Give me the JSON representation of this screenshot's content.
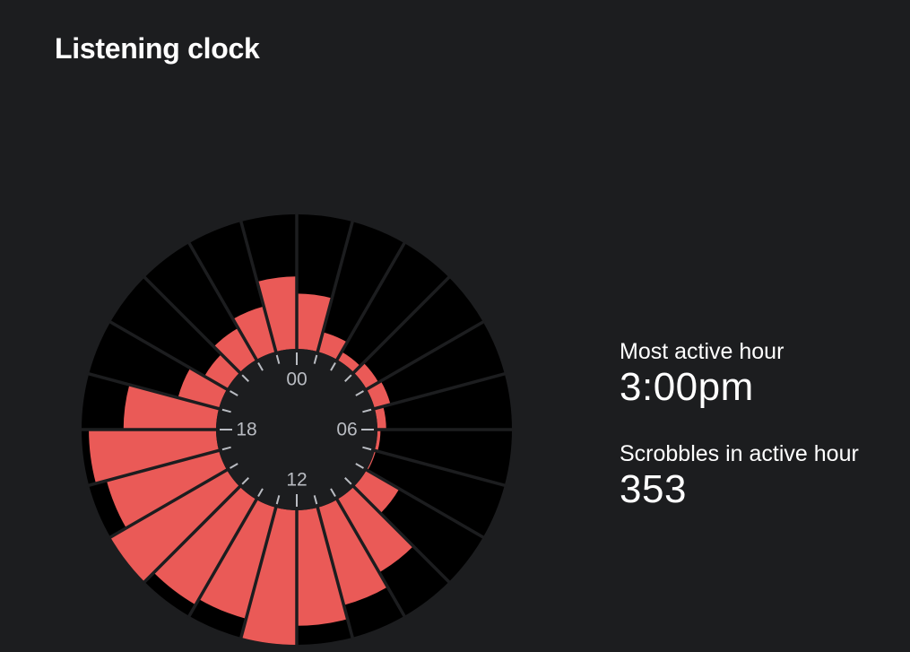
{
  "header": {
    "title": "Listening clock"
  },
  "stats": {
    "most_active_label": "Most active hour",
    "most_active_value": "3:00pm",
    "scrobbles_label": "Scrobbles in active hour",
    "scrobbles_value": "353"
  },
  "colors": {
    "background": "#1c1d1f",
    "bar": "#ea5a57",
    "track": "#000000",
    "tick": "#b9bcc2"
  },
  "chart_data": {
    "type": "bar",
    "polar": true,
    "hours": [
      0,
      1,
      2,
      3,
      4,
      5,
      6,
      7,
      8,
      9,
      10,
      11,
      12,
      13,
      14,
      15,
      16,
      17,
      18,
      19,
      20,
      21,
      22,
      23
    ],
    "values": [
      145,
      53,
      24,
      36,
      43,
      23,
      8,
      3,
      99,
      221,
      265,
      303,
      353,
      302,
      319,
      353,
      305,
      334,
      243,
      111,
      68,
      96,
      123,
      190
    ],
    "max": 353,
    "hour_labels": [
      "00",
      "06",
      "12",
      "18"
    ]
  }
}
